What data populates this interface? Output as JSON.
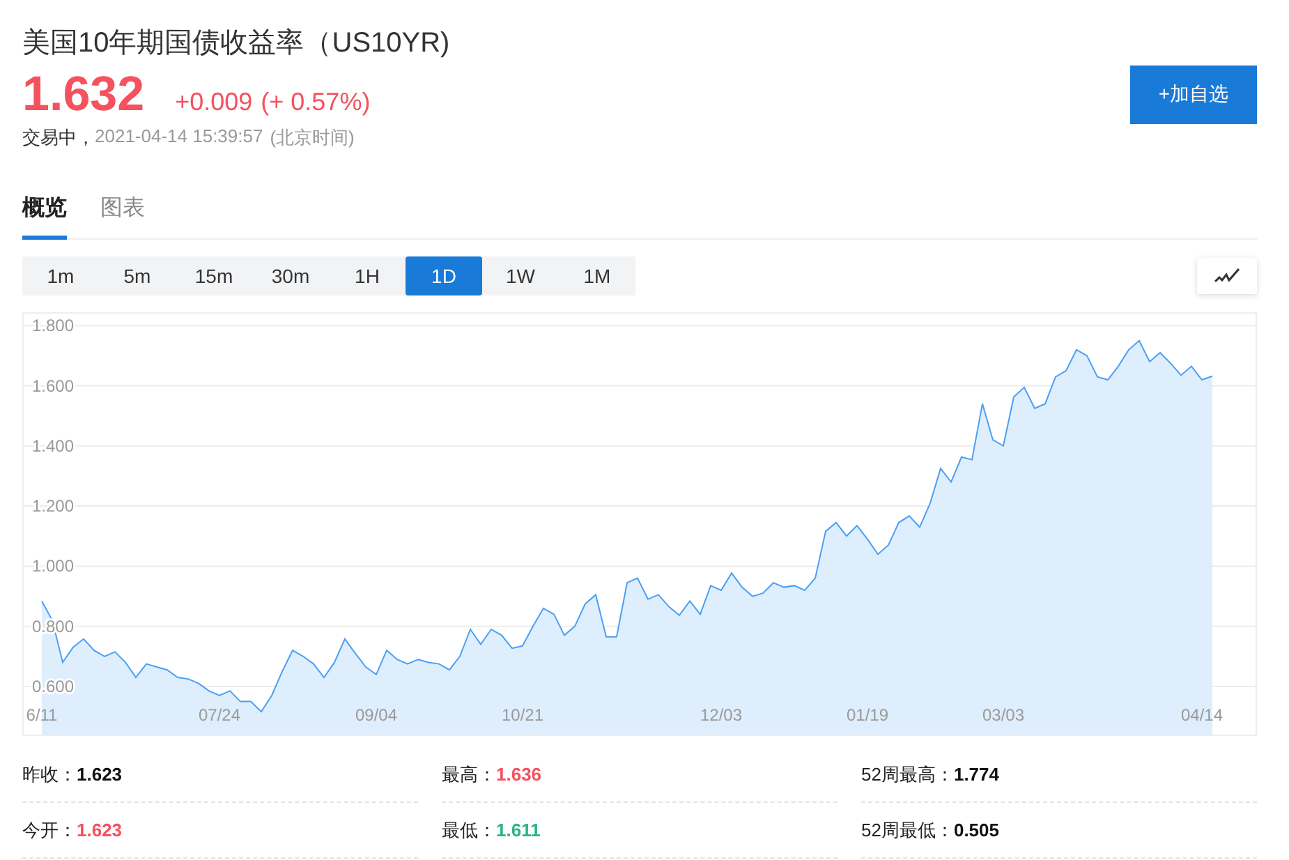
{
  "header": {
    "title": "美国10年期国债收益率（US10YR)",
    "price": "1.632",
    "change": "+0.009",
    "change_percent": "(+ 0.57%)",
    "status": "交易中，",
    "time": "2021-04-14 15:39:57",
    "timezone": "(北京时间)",
    "add_button": "+加自选"
  },
  "tabs": [
    {
      "label": "概览",
      "selected": true
    },
    {
      "label": "图表",
      "selected": false
    }
  ],
  "periods": [
    {
      "label": "1m",
      "selected": false
    },
    {
      "label": "5m",
      "selected": false
    },
    {
      "label": "15m",
      "selected": false
    },
    {
      "label": "30m",
      "selected": false
    },
    {
      "label": "1H",
      "selected": false
    },
    {
      "label": "1D",
      "selected": true
    },
    {
      "label": "1W",
      "selected": false
    },
    {
      "label": "1M",
      "selected": false
    }
  ],
  "chart": {
    "chart_data": {
      "type": "area",
      "grid": true,
      "ylim": [
        0.44,
        1.84
      ],
      "yticks": [
        {
          "value": 0.6,
          "label": "0.600"
        },
        {
          "value": 0.8,
          "label": "0.800"
        },
        {
          "value": 1.0,
          "label": "1.000"
        },
        {
          "value": 1.2,
          "label": "1.200"
        },
        {
          "value": 1.4,
          "label": "1.400"
        },
        {
          "value": 1.6,
          "label": "1.600"
        },
        {
          "value": 1.8,
          "label": "1.800"
        }
      ],
      "categories": [
        "6/11",
        null,
        null,
        null,
        null,
        null,
        null,
        null,
        null,
        null,
        null,
        null,
        null,
        null,
        null,
        null,
        null,
        "07/24",
        null,
        null,
        null,
        null,
        null,
        null,
        null,
        null,
        null,
        null,
        null,
        null,
        null,
        null,
        "09/04",
        null,
        null,
        null,
        null,
        null,
        null,
        null,
        null,
        null,
        null,
        null,
        null,
        null,
        "10/21",
        null,
        null,
        null,
        null,
        null,
        null,
        null,
        null,
        null,
        null,
        null,
        null,
        null,
        null,
        null,
        null,
        null,
        null,
        "12/03",
        null,
        null,
        null,
        null,
        null,
        null,
        null,
        null,
        null,
        null,
        null,
        null,
        null,
        "01/19",
        null,
        null,
        null,
        null,
        null,
        null,
        null,
        null,
        null,
        null,
        null,
        null,
        "03/03",
        null,
        null,
        null,
        null,
        null,
        null,
        null,
        null,
        null,
        null,
        null,
        null,
        null,
        null,
        null,
        null,
        null,
        null,
        "04/14",
        null
      ],
      "series": [
        {
          "color": "#4a9ff5",
          "values": [
            0.884,
            0.82,
            0.68,
            0.73,
            0.758,
            0.72,
            0.7,
            0.715,
            0.68,
            0.63,
            0.675,
            0.665,
            0.655,
            0.63,
            0.625,
            0.61,
            0.585,
            0.57,
            0.585,
            0.55,
            0.55,
            0.516,
            0.57,
            0.65,
            0.72,
            0.7,
            0.675,
            0.63,
            0.68,
            0.758,
            0.71,
            0.665,
            0.64,
            0.72,
            0.69,
            0.675,
            0.69,
            0.68,
            0.675,
            0.655,
            0.7,
            0.79,
            0.74,
            0.79,
            0.77,
            0.727,
            0.735,
            0.8,
            0.86,
            0.84,
            0.77,
            0.8,
            0.875,
            0.905,
            0.765,
            0.765,
            0.945,
            0.96,
            0.89,
            0.905,
            0.865,
            0.837,
            0.884,
            0.84,
            0.935,
            0.92,
            0.977,
            0.93,
            0.9,
            0.91,
            0.945,
            0.93,
            0.935,
            0.92,
            0.96,
            1.116,
            1.145,
            1.1,
            1.135,
            1.09,
            1.04,
            1.07,
            1.145,
            1.167,
            1.13,
            1.21,
            1.325,
            1.28,
            1.363,
            1.354,
            1.54,
            1.42,
            1.4,
            1.563,
            1.595,
            1.525,
            1.54,
            1.63,
            1.65,
            1.72,
            1.7,
            1.63,
            1.62,
            1.665,
            1.72,
            1.75,
            1.68,
            1.71,
            1.675,
            1.635,
            1.665,
            1.62,
            1.632
          ]
        }
      ]
    }
  },
  "stats": [
    [
      {
        "label": "昨收：",
        "value": "1.623",
        "color": "#111111"
      },
      {
        "label": "最高：",
        "value": "1.636",
        "color": "#f5515f"
      },
      {
        "label": "52周最高：",
        "value": "1.774",
        "color": "#111111"
      }
    ],
    [
      {
        "label": "今开：",
        "value": "1.623",
        "color": "#f5515f"
      },
      {
        "label": "最低：",
        "value": "1.611",
        "color": "#2bb38a"
      },
      {
        "label": "52周最低：",
        "value": "0.505",
        "color": "#111111"
      }
    ]
  ]
}
